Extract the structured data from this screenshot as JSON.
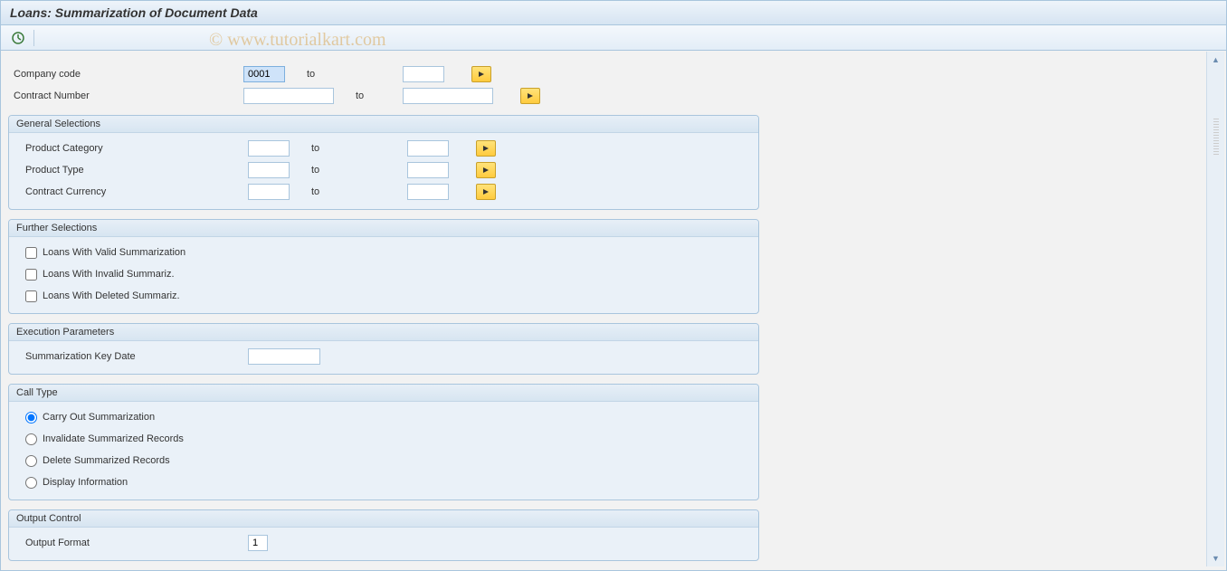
{
  "title": "Loans: Summarization of Document Data",
  "watermark": "© www.tutorialkart.com",
  "top_rows": [
    {
      "label": "Company code",
      "from": "0001",
      "to_label": "to",
      "to": "",
      "selected": true,
      "from_w": "w-sm",
      "to_w": "w-sm"
    },
    {
      "label": "Contract Number",
      "from": "",
      "to_label": "to",
      "to": "",
      "selected": false,
      "from_w": "w-lg",
      "to_w": "w-lg"
    }
  ],
  "groups": {
    "general": {
      "title": "General Selections",
      "rows": [
        {
          "label": "Product Category",
          "from": "",
          "to_label": "to",
          "to": "",
          "from_w": "w-sm",
          "to_w": "w-sm"
        },
        {
          "label": "Product Type",
          "from": "",
          "to_label": "to",
          "to": "",
          "from_w": "w-sm",
          "to_w": "w-sm"
        },
        {
          "label": "Contract Currency",
          "from": "",
          "to_label": "to",
          "to": "",
          "from_w": "w-sm",
          "to_w": "w-sm"
        }
      ]
    },
    "further": {
      "title": "Further Selections",
      "checks": [
        {
          "label": "Loans With Valid Summarization",
          "checked": false
        },
        {
          "label": "Loans With Invalid Summariz.",
          "checked": false
        },
        {
          "label": "Loans With Deleted Summariz.",
          "checked": false
        }
      ]
    },
    "exec": {
      "title": "Execution Parameters",
      "rows": [
        {
          "label": "Summarization Key Date",
          "value": "",
          "w": "w-md"
        }
      ]
    },
    "calltype": {
      "title": "Call Type",
      "radios": [
        {
          "label": "Carry Out Summarization",
          "checked": true
        },
        {
          "label": "Invalidate Summarized Records",
          "checked": false
        },
        {
          "label": "Delete Summarized Records",
          "checked": false
        },
        {
          "label": "Display Information",
          "checked": false
        }
      ]
    },
    "output": {
      "title": "Output Control",
      "rows": [
        {
          "label": "Output Format",
          "value": "1",
          "w": "w-sm"
        }
      ]
    }
  }
}
